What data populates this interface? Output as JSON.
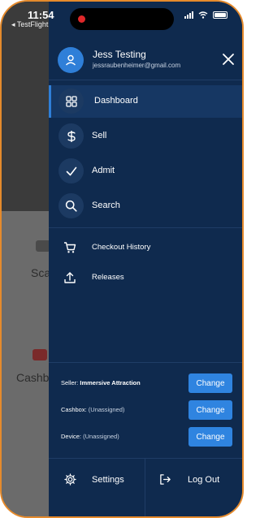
{
  "status_bar": {
    "time": "11:54",
    "back_app": "◂ TestFlight"
  },
  "background_app": {
    "labels": [
      "Sca",
      "Cashb"
    ]
  },
  "drawer": {
    "user": {
      "name": "Jess Testing",
      "email": "jessraubenheimer@gmail.com"
    },
    "nav_items": [
      {
        "label": "Dashboard",
        "icon": "grid-icon",
        "active": true
      },
      {
        "label": "Sell",
        "icon": "dollar-icon",
        "active": false
      },
      {
        "label": "Admit",
        "icon": "check-icon",
        "active": false
      },
      {
        "label": "Search",
        "icon": "search-icon",
        "active": false
      }
    ],
    "sub_items": [
      {
        "label": "Checkout History",
        "icon": "cart-icon"
      },
      {
        "label": "Releases",
        "icon": "upload-icon"
      }
    ],
    "assignments": [
      {
        "key": "Seller:",
        "value": "Immersive Attraction",
        "assigned": true,
        "button": "Change"
      },
      {
        "key": "Cashbox:",
        "value": "(Unassigned)",
        "assigned": false,
        "button": "Change"
      },
      {
        "key": "Device:",
        "value": "(Unassigned)",
        "assigned": false,
        "button": "Change"
      }
    ],
    "footer": {
      "settings_label": "Settings",
      "logout_label": "Log Out"
    }
  },
  "colors": {
    "drawer_bg": "#0f2a4e",
    "accent": "#2f84e0",
    "frame": "#e58a2c"
  }
}
